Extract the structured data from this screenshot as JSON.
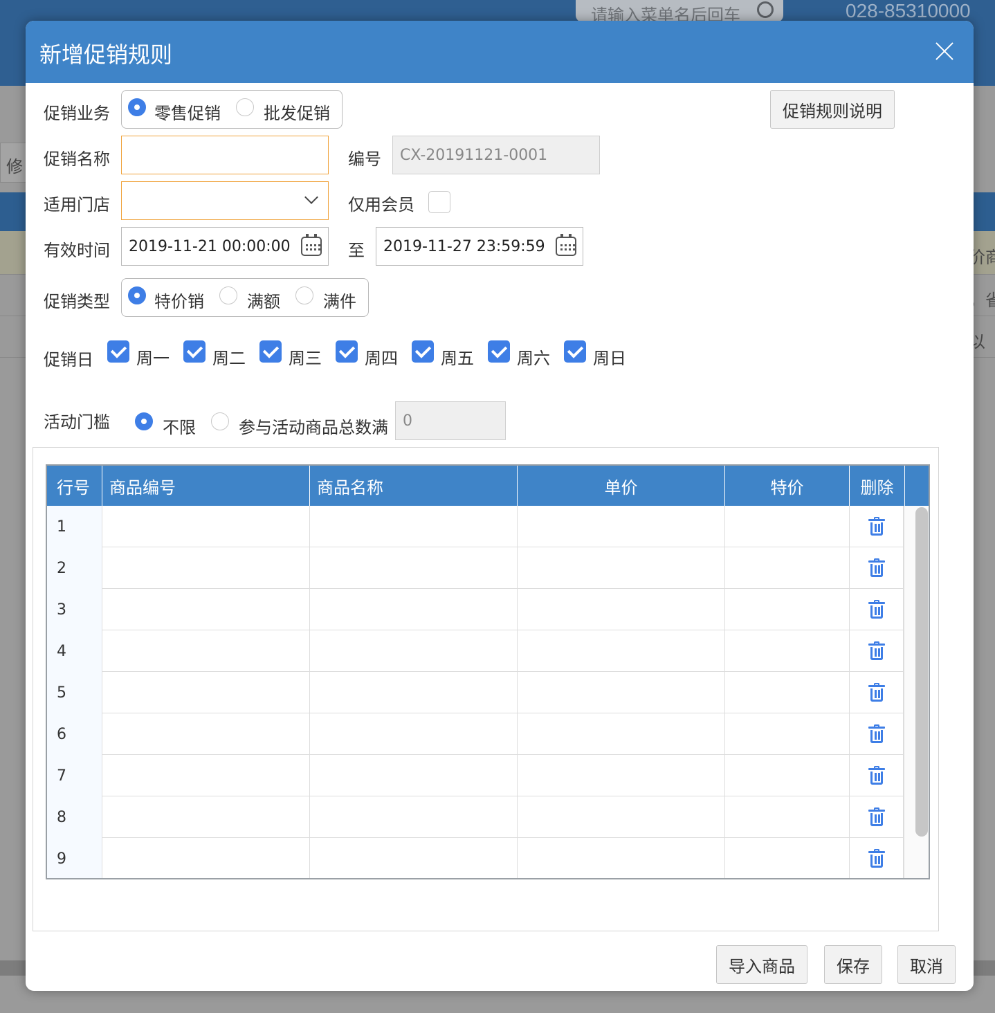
{
  "background": {
    "search_placeholder": "请输入菜单名后回车",
    "phone": "028-85310000",
    "left_button_fragment": "修",
    "right_fragments": [
      "价商",
      "，省",
      "以"
    ]
  },
  "dialog": {
    "title": "新增促销规则",
    "help_button": "促销规则说明",
    "business": {
      "label": "促销业务",
      "options": [
        "零售促销",
        "批发促销"
      ],
      "selected": "零售促销"
    },
    "name": {
      "label": "促销名称",
      "value": ""
    },
    "code": {
      "label": "编号",
      "value": "CX-20191121-0001"
    },
    "store": {
      "label": "适用门店",
      "value": ""
    },
    "members_only": {
      "label": "仅用会员",
      "checked": false
    },
    "valid_time": {
      "label": "有效时间",
      "start": "2019-11-21 00:00:00",
      "separator": "至",
      "end": "2019-11-27 23:59:59"
    },
    "promo_type": {
      "label": "促销类型",
      "options": [
        "特价销",
        "满额",
        "满件"
      ],
      "selected": "特价销"
    },
    "promo_days": {
      "label": "促销日",
      "days": [
        "周一",
        "周二",
        "周三",
        "周四",
        "周五",
        "周六",
        "周日"
      ],
      "checked": [
        true,
        true,
        true,
        true,
        true,
        true,
        true
      ]
    },
    "threshold": {
      "label": "活动门槛",
      "options": [
        "不限",
        "参与活动商品总数满"
      ],
      "selected": "不限",
      "value": "0"
    },
    "grid": {
      "columns": [
        "行号",
        "商品编号",
        "商品名称",
        "单价",
        "特价",
        "删除"
      ],
      "rows": [
        "1",
        "2",
        "3",
        "4",
        "5",
        "6",
        "7",
        "8",
        "9"
      ]
    },
    "footer": {
      "import": "导入商品",
      "save": "保存",
      "cancel": "取消"
    }
  }
}
